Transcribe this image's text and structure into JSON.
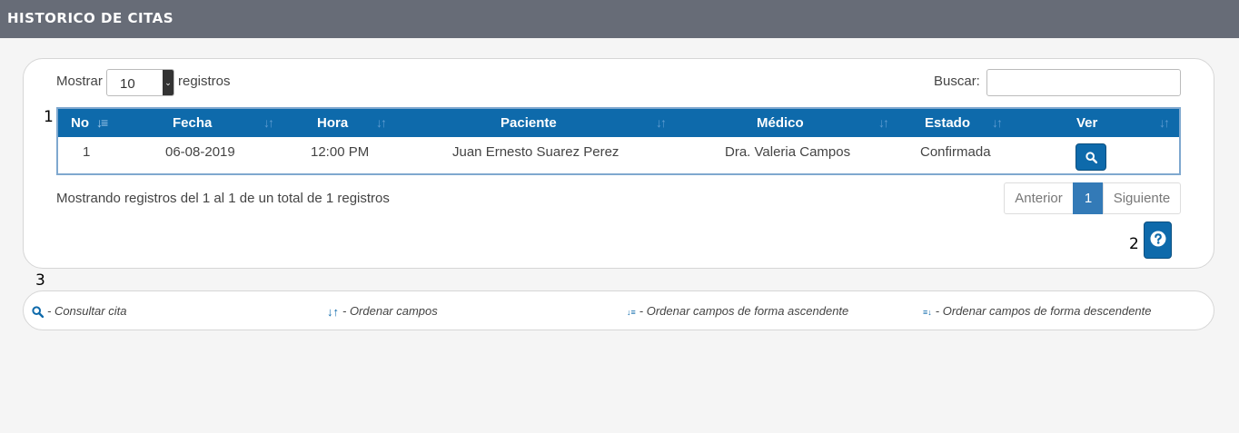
{
  "header": {
    "title": "HISTORICO DE CITAS"
  },
  "controls": {
    "mostrar_label": "Mostrar",
    "page_length": "10",
    "registros_label": "registros",
    "buscar_label": "Buscar:",
    "search_value": ""
  },
  "markers": {
    "m1": "1",
    "m2": "2",
    "m3": "3"
  },
  "table": {
    "columns": [
      "No",
      "Fecha",
      "Hora",
      "Paciente",
      "Médico",
      "Estado",
      "Ver"
    ],
    "rows": [
      {
        "no": "1",
        "fecha": "06-08-2019",
        "hora": "12:00 PM",
        "paciente": "Juan Ernesto Suarez Perez",
        "medico": "Dra. Valeria Campos",
        "estado": "Confirmada"
      }
    ]
  },
  "footer": {
    "info": "Mostrando registros del 1 al 1 de un total de 1 registros",
    "pagination": {
      "prev": "Anterior",
      "current": "1",
      "next": "Siguiente"
    }
  },
  "legend": {
    "consultar": "- Consultar cita",
    "ordenar": "- Ordenar campos",
    "ascendente": "- Ordenar campos de forma ascendente",
    "descendente": "- Ordenar campos de forma descendente"
  },
  "colors": {
    "header_bg": "#676c77",
    "accent": "#0e6aab",
    "page_active": "#337ab7"
  },
  "icons": [
    "search-icon",
    "question-circle-icon",
    "sort-both-icon",
    "sort-asc-icon",
    "sort-desc-icon",
    "chevron-down-icon"
  ]
}
